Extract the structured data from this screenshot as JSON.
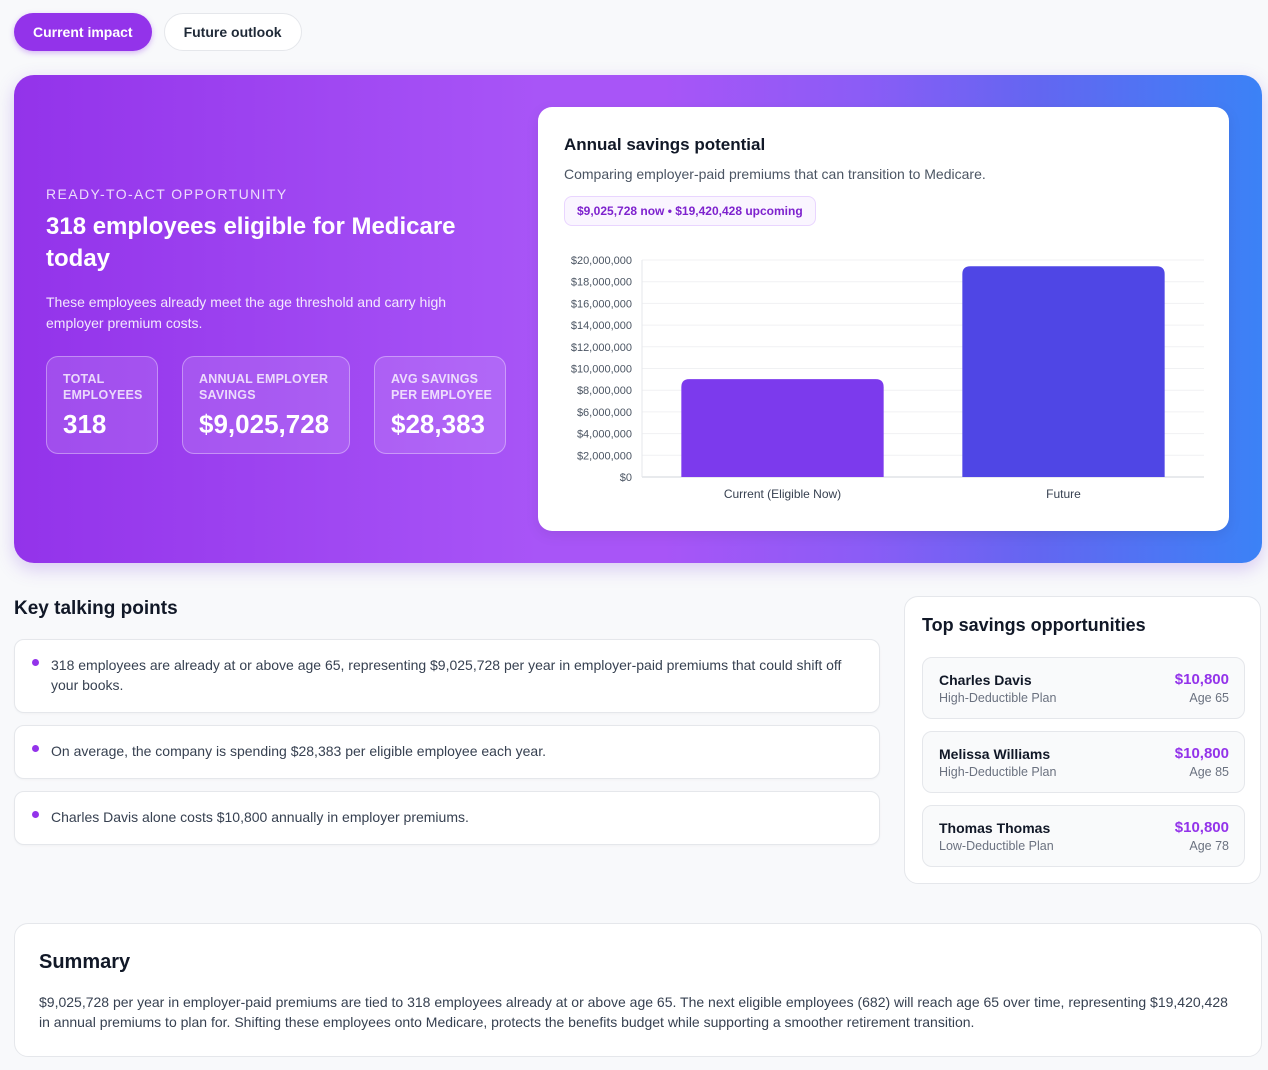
{
  "tabs": [
    {
      "label": "Current impact",
      "active": true
    },
    {
      "label": "Future outlook",
      "active": false
    }
  ],
  "hero": {
    "eyebrow": "READY-TO-ACT OPPORTUNITY",
    "title": "318 employees eligible for Medicare today",
    "description": "These employees already meet the age threshold and carry high employer premium costs.",
    "stats": [
      {
        "label": "TOTAL EMPLOYEES",
        "value": "318"
      },
      {
        "label": "ANNUAL EMPLOYER SAVINGS",
        "value": "$9,025,728"
      },
      {
        "label": "AVG SAVINGS PER EMPLOYEE",
        "value": "$28,383"
      }
    ]
  },
  "chart": {
    "title": "Annual savings potential",
    "subtitle": "Comparing employer-paid premiums that can transition to Medicare.",
    "pill": "$9,025,728 now • $19,420,428 upcoming"
  },
  "chart_data": {
    "type": "bar",
    "categories": [
      "Current (Eligible Now)",
      "Future"
    ],
    "values": [
      9025728,
      19420428
    ],
    "colors": [
      "#7c3aed",
      "#4f46e5"
    ],
    "ylim": [
      0,
      20000000
    ],
    "yticks": [
      "$0",
      "$2,000,000",
      "$4,000,000",
      "$6,000,000",
      "$8,000,000",
      "$10,000,000",
      "$12,000,000",
      "$14,000,000",
      "$16,000,000",
      "$18,000,000",
      "$20,000,000"
    ],
    "grid": true
  },
  "talking_points": {
    "title": "Key talking points",
    "items": [
      "318 employees are already at or above age 65, representing $9,025,728 per year in employer-paid premiums that could shift off your books.",
      "On average, the company is spending $28,383 per eligible employee each year.",
      "Charles Davis alone costs $10,800 annually in employer premiums."
    ]
  },
  "top_savings": {
    "title": "Top savings opportunities",
    "items": [
      {
        "name": "Charles Davis",
        "plan": "High-Deductible Plan",
        "amount": "$10,800",
        "age": "Age 65"
      },
      {
        "name": "Melissa Williams",
        "plan": "High-Deductible Plan",
        "amount": "$10,800",
        "age": "Age 85"
      },
      {
        "name": "Thomas Thomas",
        "plan": "Low-Deductible Plan",
        "amount": "$10,800",
        "age": "Age 78"
      }
    ]
  },
  "summary": {
    "title": "Summary",
    "text": "$9,025,728 per year in employer-paid premiums are tied to 318 employees already at or above age 65. The next eligible employees (682) will reach age 65 over time, representing $19,420,428 in annual premiums to plan for. Shifting these employees onto Medicare, protects the benefits budget while supporting a smoother retirement transition."
  }
}
